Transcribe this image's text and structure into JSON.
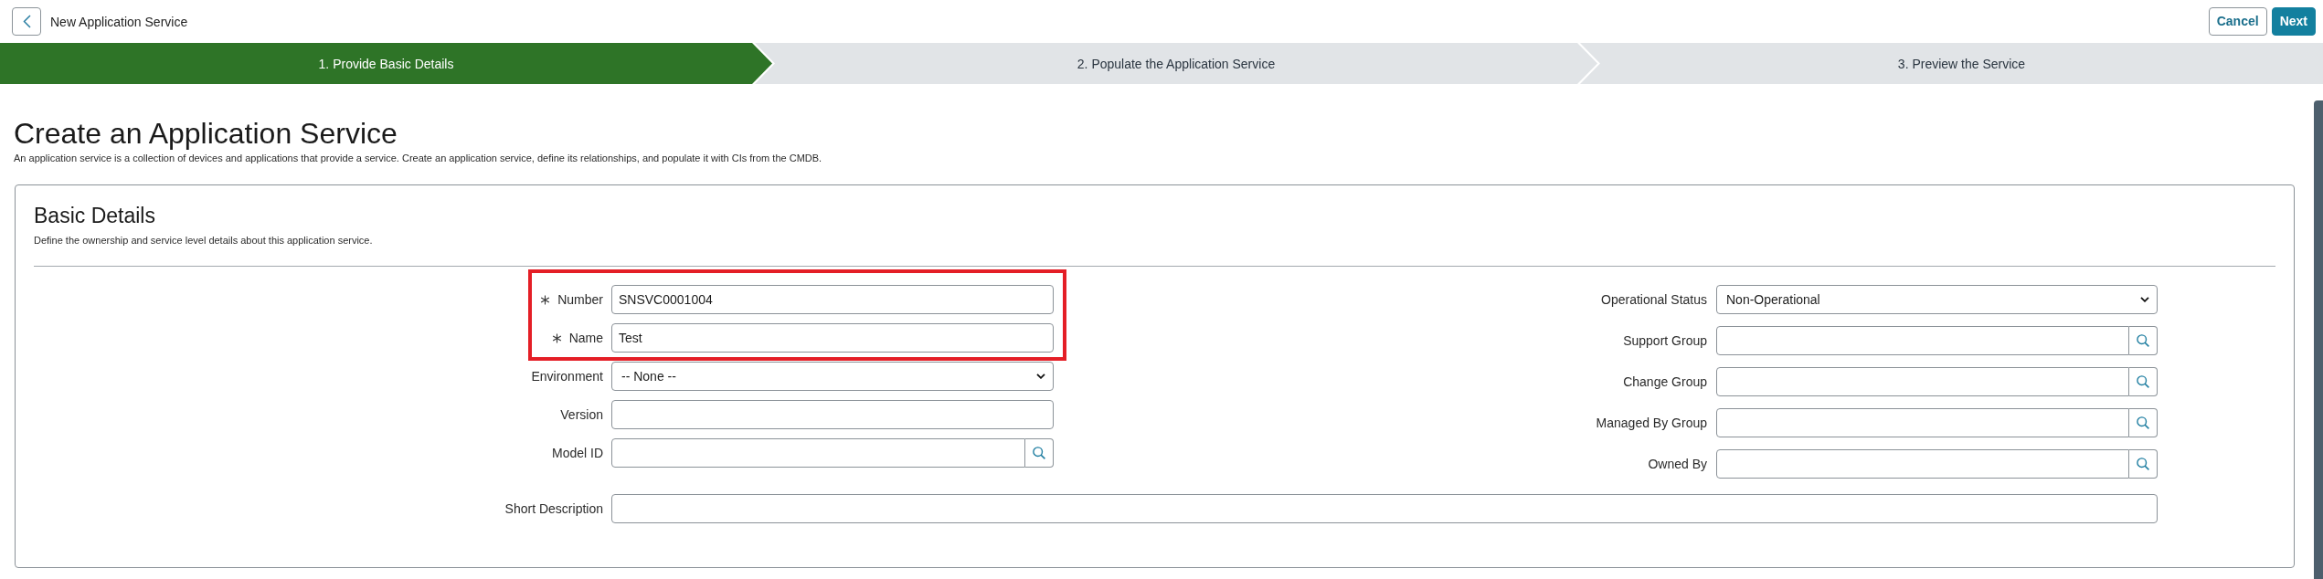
{
  "header": {
    "title": "New Application Service",
    "buttons": [
      {
        "label": "Cancel",
        "kind": "secondary"
      },
      {
        "label": "Next",
        "kind": "primary"
      }
    ]
  },
  "steps": [
    {
      "label": "1. Provide Basic Details",
      "selected": true
    },
    {
      "label": "2. Populate the Application Service",
      "selected": false
    },
    {
      "label": "3. Preview the Service",
      "selected": false
    }
  ],
  "page": {
    "title": "Create an Application Service",
    "description": "An application service is a collection of devices and applications that provide a service. Create an application service, define its relationships, and populate it with CIs from the CMDB."
  },
  "section": {
    "title": "Basic Details",
    "description": "Define the ownership and service level details about this application service.",
    "left_fields": [
      {
        "label": "Number",
        "kind": "text",
        "required": true,
        "highlighted": true,
        "value": "SNSVC0001004"
      },
      {
        "label": "Name",
        "kind": "text",
        "required": true,
        "highlighted": true,
        "value": "Test"
      },
      {
        "label": "Environment",
        "kind": "select",
        "required": false,
        "highlighted": false,
        "value": "-- None --"
      },
      {
        "label": "Version",
        "kind": "text",
        "required": false,
        "highlighted": false
      },
      {
        "label": "Model ID",
        "kind": "lookup",
        "required": false,
        "highlighted": false
      }
    ],
    "right_fields": [
      {
        "label": "Operational Status",
        "kind": "select",
        "required": false,
        "highlighted": false,
        "value": "Non-Operational"
      },
      {
        "label": "Support Group",
        "kind": "lookup",
        "required": false,
        "highlighted": false
      },
      {
        "label": "Change Group",
        "kind": "lookup",
        "required": false,
        "highlighted": false
      },
      {
        "label": "Managed By Group",
        "kind": "lookup",
        "required": false,
        "highlighted": false
      },
      {
        "label": "Owned By",
        "kind": "lookup",
        "required": false,
        "highlighted": false
      }
    ],
    "wide_fields": [
      {
        "label": "Short Description",
        "kind": "text",
        "required": false,
        "highlighted": false
      }
    ]
  }
}
